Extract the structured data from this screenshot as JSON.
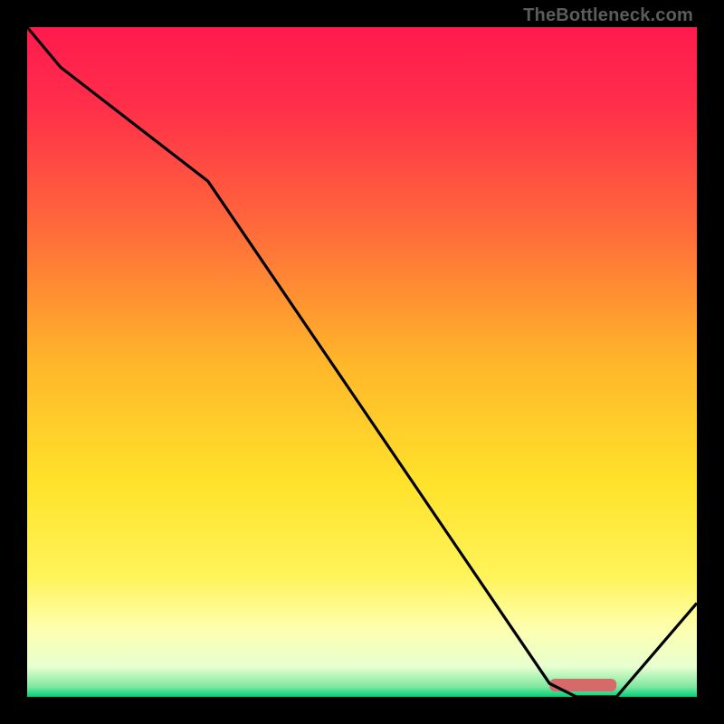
{
  "watermark": "TheBottleneck.com",
  "chart_data": {
    "type": "line",
    "title": "",
    "xlabel": "",
    "ylabel": "",
    "x": [
      0.0,
      0.05,
      0.27,
      0.78,
      0.82,
      0.88,
      1.0
    ],
    "values": [
      1.0,
      0.94,
      0.77,
      0.02,
      0.0,
      0.0,
      0.14
    ],
    "xlim": [
      0,
      1
    ],
    "ylim": [
      0,
      1
    ],
    "optimal_band": {
      "x_start": 0.78,
      "x_end": 0.88
    },
    "gradient_stops": [
      {
        "offset": 0.0,
        "color": "#ff1a4d"
      },
      {
        "offset": 0.12,
        "color": "#ff2f4a"
      },
      {
        "offset": 0.3,
        "color": "#ff6a3a"
      },
      {
        "offset": 0.5,
        "color": "#ffb62a"
      },
      {
        "offset": 0.68,
        "color": "#ffe22a"
      },
      {
        "offset": 0.82,
        "color": "#fff45a"
      },
      {
        "offset": 0.9,
        "color": "#fdffb0"
      },
      {
        "offset": 0.955,
        "color": "#e8ffd0"
      },
      {
        "offset": 0.985,
        "color": "#7fe8a0"
      },
      {
        "offset": 1.0,
        "color": "#00d07a"
      }
    ],
    "line_color": "#000000",
    "marker_color": "#d66a6a"
  }
}
